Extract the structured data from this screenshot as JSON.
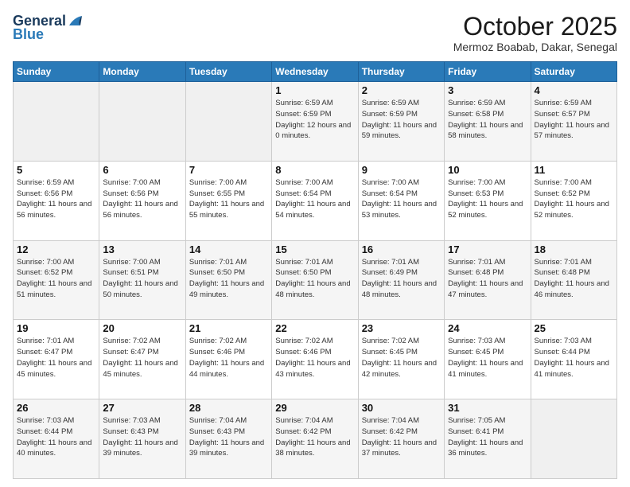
{
  "header": {
    "title": "October 2025",
    "location": "Mermoz Boabab, Dakar, Senegal"
  },
  "columns": [
    "Sunday",
    "Monday",
    "Tuesday",
    "Wednesday",
    "Thursday",
    "Friday",
    "Saturday"
  ],
  "weeks": [
    [
      null,
      null,
      null,
      {
        "day": 1,
        "sunrise": "6:59 AM",
        "sunset": "6:59 PM",
        "daylight": "12 hours and 0 minutes."
      },
      {
        "day": 2,
        "sunrise": "6:59 AM",
        "sunset": "6:59 PM",
        "daylight": "11 hours and 59 minutes."
      },
      {
        "day": 3,
        "sunrise": "6:59 AM",
        "sunset": "6:58 PM",
        "daylight": "11 hours and 58 minutes."
      },
      {
        "day": 4,
        "sunrise": "6:59 AM",
        "sunset": "6:57 PM",
        "daylight": "11 hours and 57 minutes."
      }
    ],
    [
      {
        "day": 5,
        "sunrise": "6:59 AM",
        "sunset": "6:56 PM",
        "daylight": "11 hours and 56 minutes."
      },
      {
        "day": 6,
        "sunrise": "7:00 AM",
        "sunset": "6:56 PM",
        "daylight": "11 hours and 56 minutes."
      },
      {
        "day": 7,
        "sunrise": "7:00 AM",
        "sunset": "6:55 PM",
        "daylight": "11 hours and 55 minutes."
      },
      {
        "day": 8,
        "sunrise": "7:00 AM",
        "sunset": "6:54 PM",
        "daylight": "11 hours and 54 minutes."
      },
      {
        "day": 9,
        "sunrise": "7:00 AM",
        "sunset": "6:54 PM",
        "daylight": "11 hours and 53 minutes."
      },
      {
        "day": 10,
        "sunrise": "7:00 AM",
        "sunset": "6:53 PM",
        "daylight": "11 hours and 52 minutes."
      },
      {
        "day": 11,
        "sunrise": "7:00 AM",
        "sunset": "6:52 PM",
        "daylight": "11 hours and 52 minutes."
      }
    ],
    [
      {
        "day": 12,
        "sunrise": "7:00 AM",
        "sunset": "6:52 PM",
        "daylight": "11 hours and 51 minutes."
      },
      {
        "day": 13,
        "sunrise": "7:00 AM",
        "sunset": "6:51 PM",
        "daylight": "11 hours and 50 minutes."
      },
      {
        "day": 14,
        "sunrise": "7:01 AM",
        "sunset": "6:50 PM",
        "daylight": "11 hours and 49 minutes."
      },
      {
        "day": 15,
        "sunrise": "7:01 AM",
        "sunset": "6:50 PM",
        "daylight": "11 hours and 48 minutes."
      },
      {
        "day": 16,
        "sunrise": "7:01 AM",
        "sunset": "6:49 PM",
        "daylight": "11 hours and 48 minutes."
      },
      {
        "day": 17,
        "sunrise": "7:01 AM",
        "sunset": "6:48 PM",
        "daylight": "11 hours and 47 minutes."
      },
      {
        "day": 18,
        "sunrise": "7:01 AM",
        "sunset": "6:48 PM",
        "daylight": "11 hours and 46 minutes."
      }
    ],
    [
      {
        "day": 19,
        "sunrise": "7:01 AM",
        "sunset": "6:47 PM",
        "daylight": "11 hours and 45 minutes."
      },
      {
        "day": 20,
        "sunrise": "7:02 AM",
        "sunset": "6:47 PM",
        "daylight": "11 hours and 45 minutes."
      },
      {
        "day": 21,
        "sunrise": "7:02 AM",
        "sunset": "6:46 PM",
        "daylight": "11 hours and 44 minutes."
      },
      {
        "day": 22,
        "sunrise": "7:02 AM",
        "sunset": "6:46 PM",
        "daylight": "11 hours and 43 minutes."
      },
      {
        "day": 23,
        "sunrise": "7:02 AM",
        "sunset": "6:45 PM",
        "daylight": "11 hours and 42 minutes."
      },
      {
        "day": 24,
        "sunrise": "7:03 AM",
        "sunset": "6:45 PM",
        "daylight": "11 hours and 41 minutes."
      },
      {
        "day": 25,
        "sunrise": "7:03 AM",
        "sunset": "6:44 PM",
        "daylight": "11 hours and 41 minutes."
      }
    ],
    [
      {
        "day": 26,
        "sunrise": "7:03 AM",
        "sunset": "6:44 PM",
        "daylight": "11 hours and 40 minutes."
      },
      {
        "day": 27,
        "sunrise": "7:03 AM",
        "sunset": "6:43 PM",
        "daylight": "11 hours and 39 minutes."
      },
      {
        "day": 28,
        "sunrise": "7:04 AM",
        "sunset": "6:43 PM",
        "daylight": "11 hours and 39 minutes."
      },
      {
        "day": 29,
        "sunrise": "7:04 AM",
        "sunset": "6:42 PM",
        "daylight": "11 hours and 38 minutes."
      },
      {
        "day": 30,
        "sunrise": "7:04 AM",
        "sunset": "6:42 PM",
        "daylight": "11 hours and 37 minutes."
      },
      {
        "day": 31,
        "sunrise": "7:05 AM",
        "sunset": "6:41 PM",
        "daylight": "11 hours and 36 minutes."
      },
      null
    ]
  ],
  "labels": {
    "sunrise": "Sunrise:",
    "sunset": "Sunset:",
    "daylight": "Daylight:"
  }
}
